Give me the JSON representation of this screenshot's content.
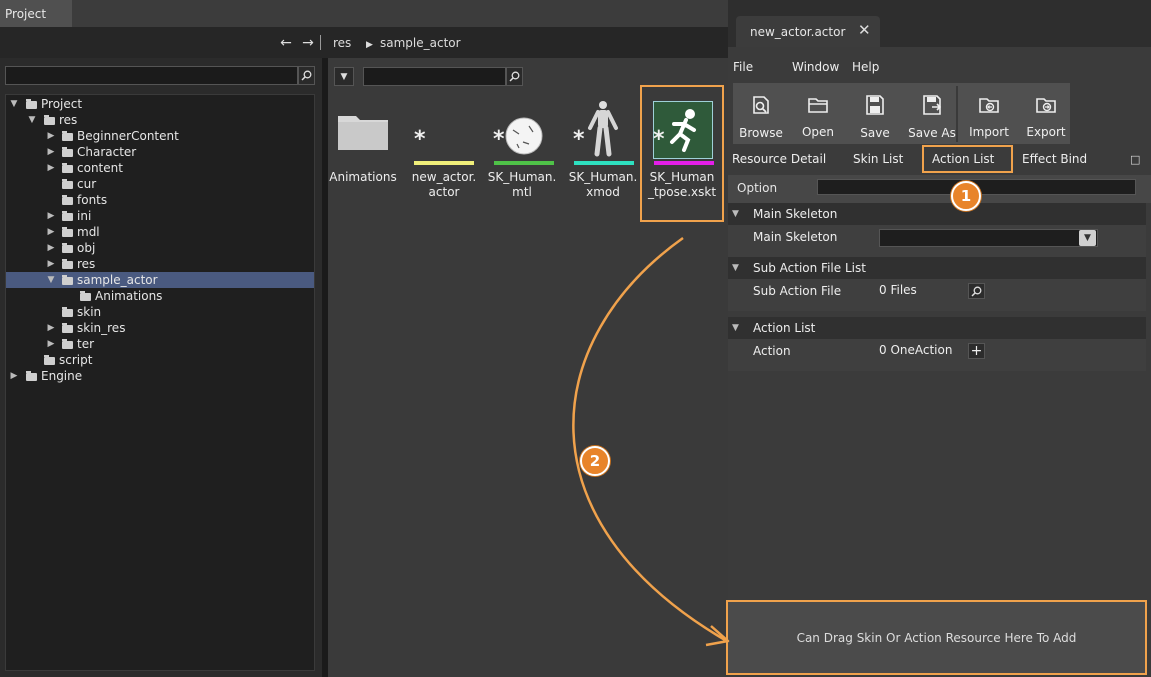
{
  "project_panel": {
    "tab_label": "Project",
    "breadcrumb": [
      "res",
      "sample_actor"
    ],
    "tree": [
      {
        "label": "Project",
        "expanded": true
      },
      {
        "label": "res",
        "expanded": true
      },
      {
        "label": "BeginnerContent",
        "expanded": false
      },
      {
        "label": "Character",
        "expanded": false
      },
      {
        "label": "content",
        "expanded": false
      },
      {
        "label": "cur",
        "expanded": null
      },
      {
        "label": "fonts",
        "expanded": null
      },
      {
        "label": "ini",
        "expanded": false
      },
      {
        "label": "mdl",
        "expanded": false
      },
      {
        "label": "obj",
        "expanded": false
      },
      {
        "label": "res",
        "expanded": false
      },
      {
        "label": "sample_actor",
        "expanded": true,
        "selected": true
      },
      {
        "label": "Animations",
        "expanded": null
      },
      {
        "label": "skin",
        "expanded": null
      },
      {
        "label": "skin_res",
        "expanded": false
      },
      {
        "label": "ter",
        "expanded": false
      },
      {
        "label": "script",
        "expanded": null
      },
      {
        "label": "Engine",
        "expanded": false
      }
    ]
  },
  "assets": [
    {
      "name": "Animations",
      "icon": "folder-icon",
      "color": ""
    },
    {
      "name": "new_actor.actor",
      "icon": "asterisk-icon",
      "color": "#f0ef7a"
    },
    {
      "name": "SK_Human.mtl",
      "icon": "material-sphere-icon",
      "color": "#4fc248"
    },
    {
      "name": "SK_Human.xmod",
      "icon": "human-model-icon",
      "color": "#2ee0c0"
    },
    {
      "name": "SK_Human_tpose.xskt",
      "icon": "running-man-icon",
      "color": "#e41ee8"
    }
  ],
  "editor": {
    "tab_title": "new_actor.actor",
    "menu": [
      "File",
      "Window",
      "Help"
    ],
    "toolbar": {
      "browse": "Browse",
      "open": "Open",
      "save": "Save",
      "save_as": "Save As",
      "import": "Import",
      "export": "Export"
    },
    "tabs": [
      "Resource Detail",
      "Skin List",
      "Action List",
      "Effect Bind"
    ],
    "active_tab": "Action List",
    "option_label": "Option",
    "sections": {
      "main_skeleton": {
        "title": "Main Skeleton",
        "field_label": "Main Skeleton",
        "value": ""
      },
      "sub_action": {
        "title": "Sub Action File List",
        "field_label": "Sub Action File",
        "value": "0 Files"
      },
      "action_list": {
        "title": "Action List",
        "field_label": "Action",
        "value": "0 OneAction"
      }
    },
    "drop_hint": "Can Drag Skin Or Action Resource Here To Add"
  },
  "annotations": {
    "badge1": "1",
    "badge2": "2"
  },
  "colors": {
    "highlight": "#f0a24c",
    "badge": "#e8842a",
    "selection": "#4a5a80"
  }
}
